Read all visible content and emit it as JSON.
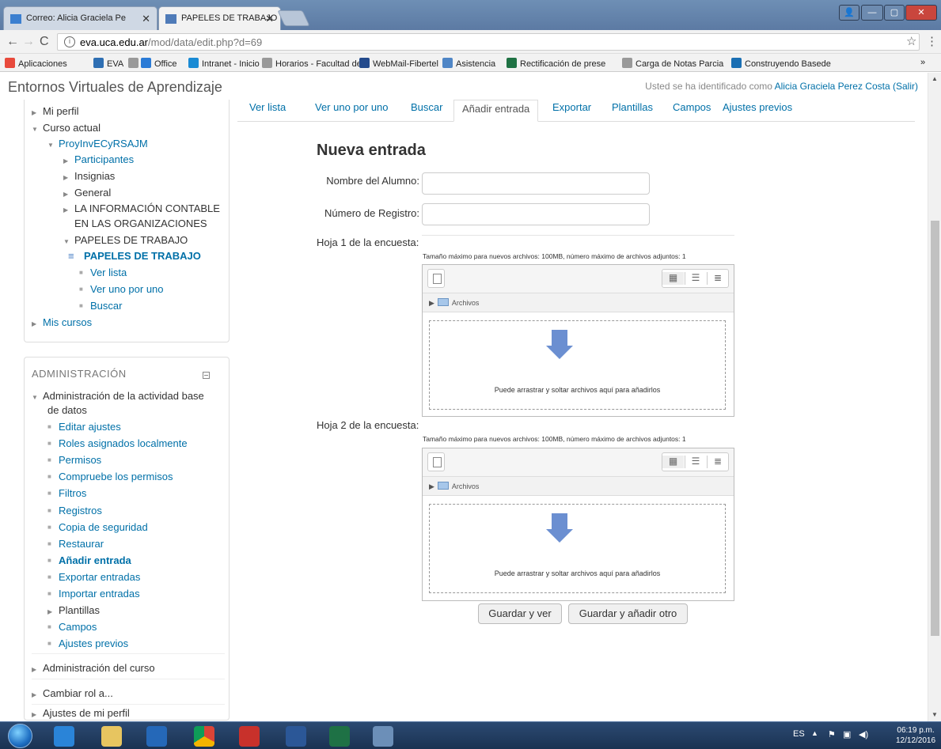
{
  "browser": {
    "tabs": [
      {
        "label": "Correo: Alicia Graciela Pe"
      },
      {
        "label": "PAPELES DE TRABAJO"
      }
    ],
    "url_host": "eva.uca.edu.ar",
    "url_path": "/mod/data/edit.php?d=69",
    "bookmarks": [
      {
        "label": "Aplicaciones",
        "color": "#e84a3c"
      },
      {
        "label": "EVA",
        "color": "#2f6fb3"
      },
      {
        "label": "",
        "color": "#999999"
      },
      {
        "label": "Office",
        "color": "#2b7bd6"
      },
      {
        "label": "Intranet - Inicio",
        "color": "#1a8bd4"
      },
      {
        "label": "Horarios - Facultad de",
        "color": "#999999"
      },
      {
        "label": "WebMail-Fibertel",
        "color": "#234a8c"
      },
      {
        "label": "Asistencia",
        "color": "#4f86c6"
      },
      {
        "label": "Rectificación de prese",
        "color": "#1f7244"
      },
      {
        "label": "Carga de Notas Parcia",
        "color": "#999999"
      },
      {
        "label": "Construyendo Basede",
        "color": "#1a6fb3"
      }
    ],
    "more": "»"
  },
  "header": {
    "site_name": "Entornos Virtuales de Aprendizaje",
    "login_prefix": "Usted se ha identificado como",
    "user": "Alicia Graciela Perez Costa",
    "logout": "(Salir)"
  },
  "nav": [
    {
      "label": "Mi perfil",
      "link": false
    },
    {
      "label": "Curso actual",
      "link": false
    },
    {
      "label": "ProyInvECyRSAJM",
      "link": true
    },
    {
      "label": "Participantes",
      "link": true
    },
    {
      "label": "Insignias",
      "link": false
    },
    {
      "label": "General",
      "link": false
    },
    {
      "label": "LA INFORMACIÓN CONTABLE",
      "link": false
    },
    {
      "label": "EN LAS ORGANIZACIONES",
      "link": false
    },
    {
      "label": "PAPELES DE TRABAJO",
      "link": false
    },
    {
      "label": "PAPELES DE TRABAJO",
      "link": true
    },
    {
      "label": "Ver lista",
      "link": true
    },
    {
      "label": "Ver uno por uno",
      "link": true
    },
    {
      "label": "Buscar",
      "link": true
    },
    {
      "label": "Mis cursos",
      "link": true
    }
  ],
  "admin": {
    "title": "ADMINISTRACIÓN",
    "section": "Administración de la actividad base",
    "section2": "de datos",
    "items": [
      "Editar ajustes",
      "Roles asignados localmente",
      "Permisos",
      "Compruebe los permisos",
      "Filtros",
      "Registros",
      "Copia de seguridad",
      "Restaurar",
      "Añadir entrada",
      "Exportar entradas",
      "Importar entradas",
      "Plantillas",
      "Campos",
      "Ajustes previos"
    ],
    "footer": [
      "Administración del curso",
      "Cambiar rol a...",
      "Ajustes de mi perfil"
    ]
  },
  "tabs": [
    "Ver lista",
    "Ver uno por uno",
    "Buscar",
    "Añadir entrada",
    "Exportar",
    "Plantillas",
    "Campos",
    "Ajustes previos"
  ],
  "form": {
    "title": "Nueva entrada",
    "student_label": "Nombre del Alumno:",
    "student_value": "",
    "reg_label": "Número de Registro:",
    "reg_value": "",
    "sheet1_label": "Hoja 1 de la encuesta:",
    "sheet2_label": "Hoja 2 de la encuesta:",
    "hint": "Tamaño máximo para nuevos archivos: 100MB, número máximo de archivos adjuntos: 1",
    "folder": "Archivos",
    "drop_text": "Puede arrastrar y soltar archivos aquí para añadirlos",
    "save_view": "Guardar y ver",
    "save_add": "Guardar y añadir otro"
  },
  "taskbar": {
    "lang": "ES",
    "time": "06:19 p.m.",
    "date": "12/12/2016"
  }
}
